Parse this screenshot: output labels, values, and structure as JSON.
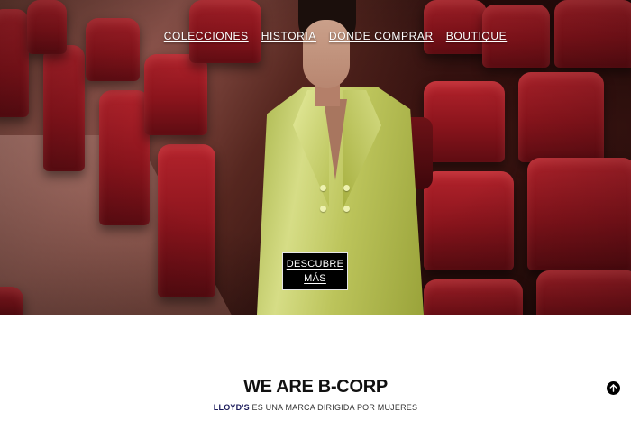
{
  "nav": {
    "items": [
      {
        "label": "COLECCIONES"
      },
      {
        "label": "HISTORIA"
      },
      {
        "label": "DONDE COMPRAR"
      },
      {
        "label": "BOUTIQUE"
      }
    ]
  },
  "hero": {
    "cta_label": "DESCUBRE MÁS"
  },
  "section": {
    "headline": "WE ARE B-CORP",
    "tagline_brand": "LLOYD'S",
    "tagline_rest": " ES UNA MARCA DIRIGIDA POR MUJERES"
  },
  "icons": {
    "scroll_top": "arrow-up-circle-icon"
  },
  "colors": {
    "cta_bg": "#000000",
    "cta_text": "#ffffff",
    "headline": "#111111",
    "brand": "#1a1a5a"
  }
}
